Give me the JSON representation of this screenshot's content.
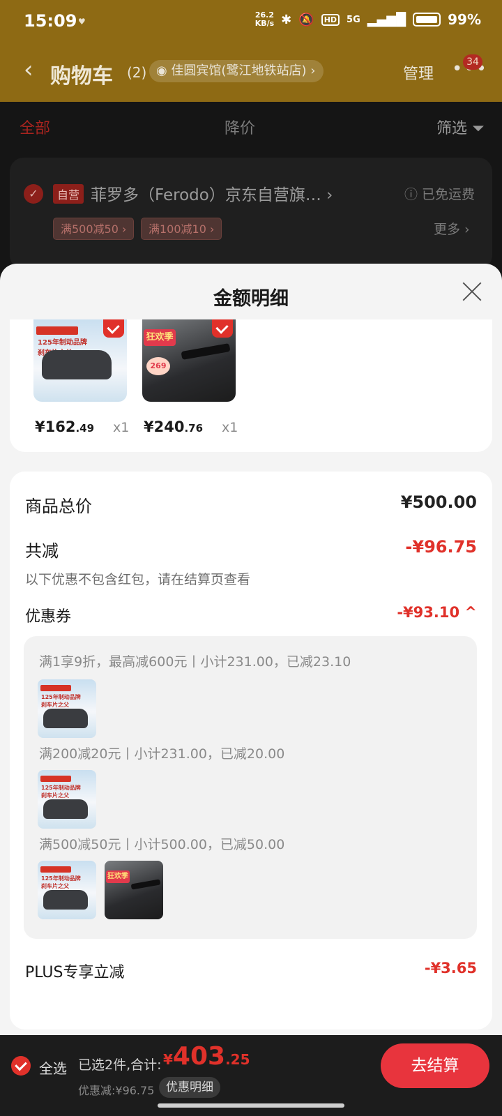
{
  "status": {
    "time": "15:09",
    "speed": "26.2\nKB/s",
    "network": "5G",
    "battery": "99%"
  },
  "header": {
    "back": "‹",
    "title": "购物车",
    "count": "(2)",
    "address": "佳圆宾馆(鹭江地铁站店) ›",
    "manage": "管理",
    "more": "•••",
    "badge": "34"
  },
  "tabs": {
    "all": "全部",
    "price_drop": "降价",
    "filter": "筛选"
  },
  "store": {
    "tag": "自营",
    "name": "菲罗多（Ferodo）京东自营旗… ›",
    "free_shipping": "ⓘ 已免运费",
    "coupons": [
      "满500减50 ›",
      "满100减10 ›"
    ],
    "more": "更多 ›"
  },
  "sheet": {
    "title": "金额明细",
    "products": [
      {
        "price_int": "¥162",
        "price_dec": ".49",
        "qty": "x1",
        "thumb_text": "125年制动品牌\n刹车片之父",
        "icon": "brake-pad-image"
      },
      {
        "price_int": "¥240",
        "price_dec": ".76",
        "qty": "x1",
        "thumb_text": "狂欢季",
        "thumb_price": "269",
        "icon": "monitor-arm-image"
      }
    ],
    "total_label": "商品总价",
    "total_value": "¥500.00",
    "discount_label": "共减",
    "discount_value": "-¥96.75",
    "note": "以下优惠不包含红包，请在结算页查看",
    "coupon_label": "优惠券",
    "coupon_value": "-¥93.10 ^",
    "coupon_rules": [
      "满1享9折，最高减600元丨小计231.00，已减23.10",
      "满200减20元丨小计231.00，已减20.00",
      "满500减50元丨小计500.00，已减50.00"
    ],
    "plus_label": "PLUS专享立减",
    "plus_value": "-¥3.65"
  },
  "bottom": {
    "select_all": "全选",
    "selected": "已选2件,合计:",
    "total_cur": "¥",
    "total_int": "403",
    "total_dec": ".25",
    "saved": "优惠减:¥96.75",
    "detail": "优惠明细",
    "checkout": "去结算"
  },
  "colors": {
    "accent_red": "#e0312a",
    "header_gold": "#8e6a14",
    "checkout_red": "#e8343d"
  }
}
